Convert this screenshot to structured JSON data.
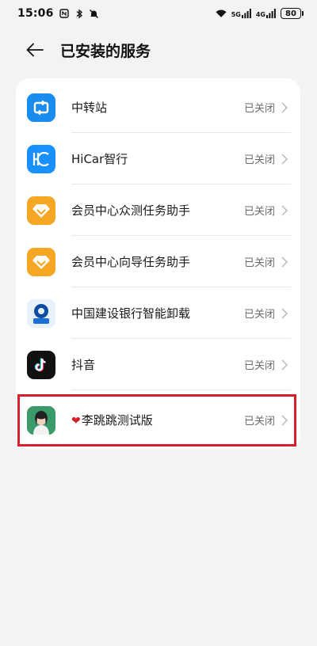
{
  "status_bar": {
    "time": "15:06",
    "signal1_label": "5G",
    "signal2_label": "4G",
    "battery": "80"
  },
  "header": {
    "title": "已安装的服务"
  },
  "services": [
    {
      "name": "中转站",
      "status": "已关闭",
      "icon": "transfer-station-icon"
    },
    {
      "name": "HiCar智行",
      "status": "已关闭",
      "icon": "hicar-icon"
    },
    {
      "name": "会员中心众测任务助手",
      "status": "已关闭",
      "icon": "member-diamond-icon"
    },
    {
      "name": "会员中心向导任务助手",
      "status": "已关闭",
      "icon": "member-diamond-icon"
    },
    {
      "name": "中国建设银行智能卸载",
      "status": "已关闭",
      "icon": "ccb-icon"
    },
    {
      "name": "抖音",
      "status": "已关闭",
      "icon": "douyin-icon"
    },
    {
      "name": "李跳跳测试版",
      "status": "已关闭",
      "icon": "avatar-icon"
    }
  ],
  "colors": {
    "highlight": "#d71f2b",
    "background": "#f1f3f5"
  }
}
